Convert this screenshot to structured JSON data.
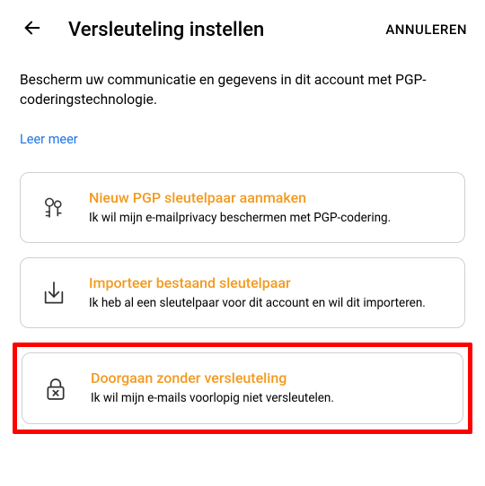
{
  "header": {
    "title": "Versleuteling instellen",
    "cancel": "ANNULEREN"
  },
  "intro": "Bescherm uw communicatie en gegevens in dit account met PGP-coderingstechnologie.",
  "learn_more": "Leer meer",
  "options": {
    "create": {
      "title": "Nieuw PGP sleutelpaar aanmaken",
      "desc": "Ik wil mijn e-mailprivacy beschermen met PGP-codering."
    },
    "import": {
      "title": "Importeer bestaand sleutelpaar",
      "desc": "Ik heb al een sleutelpaar voor dit account en wil dit importeren."
    },
    "skip": {
      "title": "Doorgaan zonder versleuteling",
      "desc": "Ik wil mijn e-mails voorlopig niet versleutelen."
    }
  }
}
